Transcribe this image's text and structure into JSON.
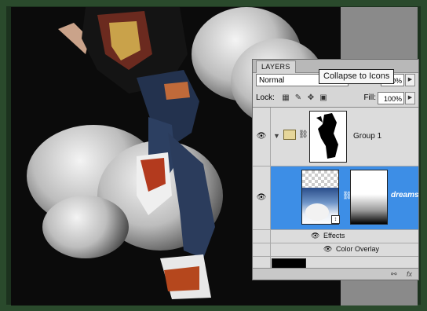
{
  "layers_panel": {
    "tab_title": "LAYERS",
    "blend_mode": "Normal",
    "opacity_value": "0%",
    "tooltip": "Collapse to Icons",
    "lock_label": "Lock:",
    "fill_label": "Fill:",
    "fill_value": "100%",
    "layers": [
      {
        "name": "Group 1"
      },
      {
        "name": "dreamsti"
      }
    ],
    "effects_label": "Effects",
    "color_overlay_label": "Color Overlay",
    "selected_color": "#3d8ee6"
  }
}
